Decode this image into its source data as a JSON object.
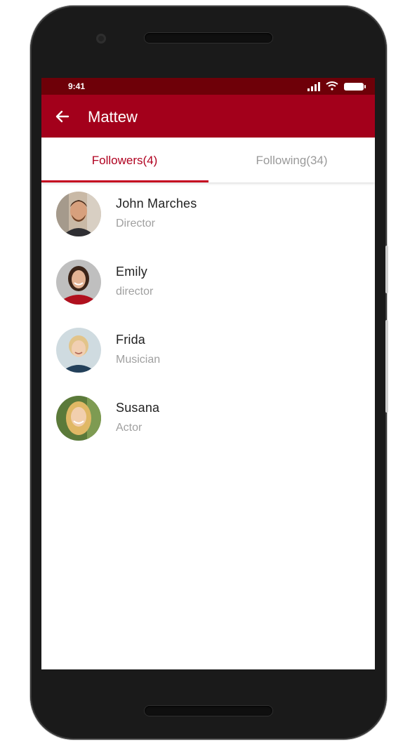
{
  "status_bar": {
    "time": "9:41",
    "icons": [
      "signal-icon",
      "wifi-icon",
      "battery-icon"
    ]
  },
  "app_bar": {
    "title": "Mattew",
    "back_icon": "arrow-left-icon"
  },
  "tabs": [
    {
      "label": "Followers(4)",
      "active": true
    },
    {
      "label": "Following(34)",
      "active": false
    }
  ],
  "followers": [
    {
      "name": "John Marches",
      "role": "Director"
    },
    {
      "name": "Emily",
      "role": "director"
    },
    {
      "name": "Frida",
      "role": "Musician"
    },
    {
      "name": "Susana",
      "role": "Actor"
    }
  ],
  "colors": {
    "primary": "#a3001b",
    "status_bar": "#6e0008",
    "accent": "#c4001f"
  }
}
